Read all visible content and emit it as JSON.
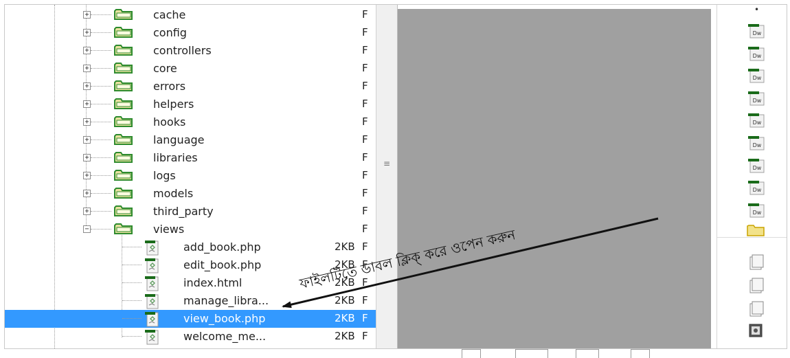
{
  "file_tree": {
    "folders": [
      {
        "name": "cache",
        "type": "F"
      },
      {
        "name": "config",
        "type": "F"
      },
      {
        "name": "controllers",
        "type": "F"
      },
      {
        "name": "core",
        "type": "F"
      },
      {
        "name": "errors",
        "type": "F"
      },
      {
        "name": "helpers",
        "type": "F"
      },
      {
        "name": "hooks",
        "type": "F"
      },
      {
        "name": "language",
        "type": "F"
      },
      {
        "name": "libraries",
        "type": "F"
      },
      {
        "name": "logs",
        "type": "F"
      },
      {
        "name": "models",
        "type": "F"
      },
      {
        "name": "third_party",
        "type": "F"
      }
    ],
    "open_folder": {
      "name": "views",
      "type": "F",
      "toggle": "−"
    },
    "collapsed_toggle": "+",
    "files": [
      {
        "name": "add_book.php",
        "size": "2KB",
        "type": "F"
      },
      {
        "name": "edit_book.php",
        "size": "2KB",
        "type": "F"
      },
      {
        "name": "index.html",
        "size": "2KB",
        "type": "F"
      },
      {
        "name": "manage_libra...",
        "size": "2KB",
        "type": "F"
      },
      {
        "name": "view_book.php",
        "size": "2KB",
        "type": "F",
        "selected": true
      },
      {
        "name": "welcome_me...",
        "size": "2KB",
        "type": "F"
      }
    ]
  },
  "divider": {
    "grip": "≡"
  },
  "annotation": {
    "text": "ফাইলটিতে ডাবল ক্লিক্ করে ওপেন করুন",
    "color": "#111111"
  },
  "sidebar": {
    "top_mark": "•",
    "file_icons": [
      "dw-file-icon",
      "dw-file-icon",
      "dw-file-icon",
      "dw-file-icon",
      "dw-file-icon",
      "dw-file-icon",
      "dw-file-icon",
      "dw-file-icon",
      "dw-file-icon"
    ],
    "dw_label": "Dw"
  },
  "colors": {
    "selection": "#3399ff",
    "preview_bg": "#a0a0a0",
    "folder_fill": "#e9e3a0",
    "folder_stroke": "#2e8b2e",
    "file_bar": "#1a6b1a"
  }
}
